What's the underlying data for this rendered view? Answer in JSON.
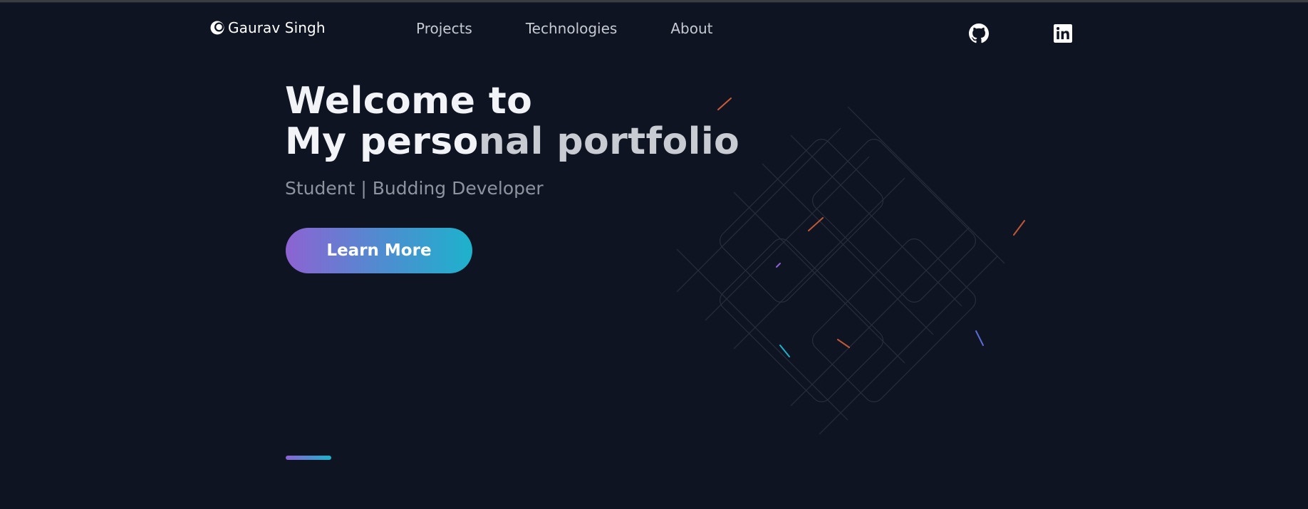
{
  "header": {
    "brand_name": "Gaurav Singh",
    "brand_icon": "crescent-logo-icon",
    "nav": [
      {
        "label": "Projects"
      },
      {
        "label": "Technologies"
      },
      {
        "label": "About"
      }
    ],
    "social": [
      {
        "icon": "github-icon"
      },
      {
        "icon": "linkedin-icon"
      }
    ]
  },
  "hero": {
    "title_line1": "Welcome to",
    "title_line2_start": "My perso",
    "title_line2_end": "nal portfolio",
    "subtitle": "Student | Budding Developer",
    "cta_label": "Learn More"
  },
  "colors": {
    "background": "#0e1421",
    "accent_start": "#8d63d2",
    "accent_end": "#1db2cc"
  }
}
